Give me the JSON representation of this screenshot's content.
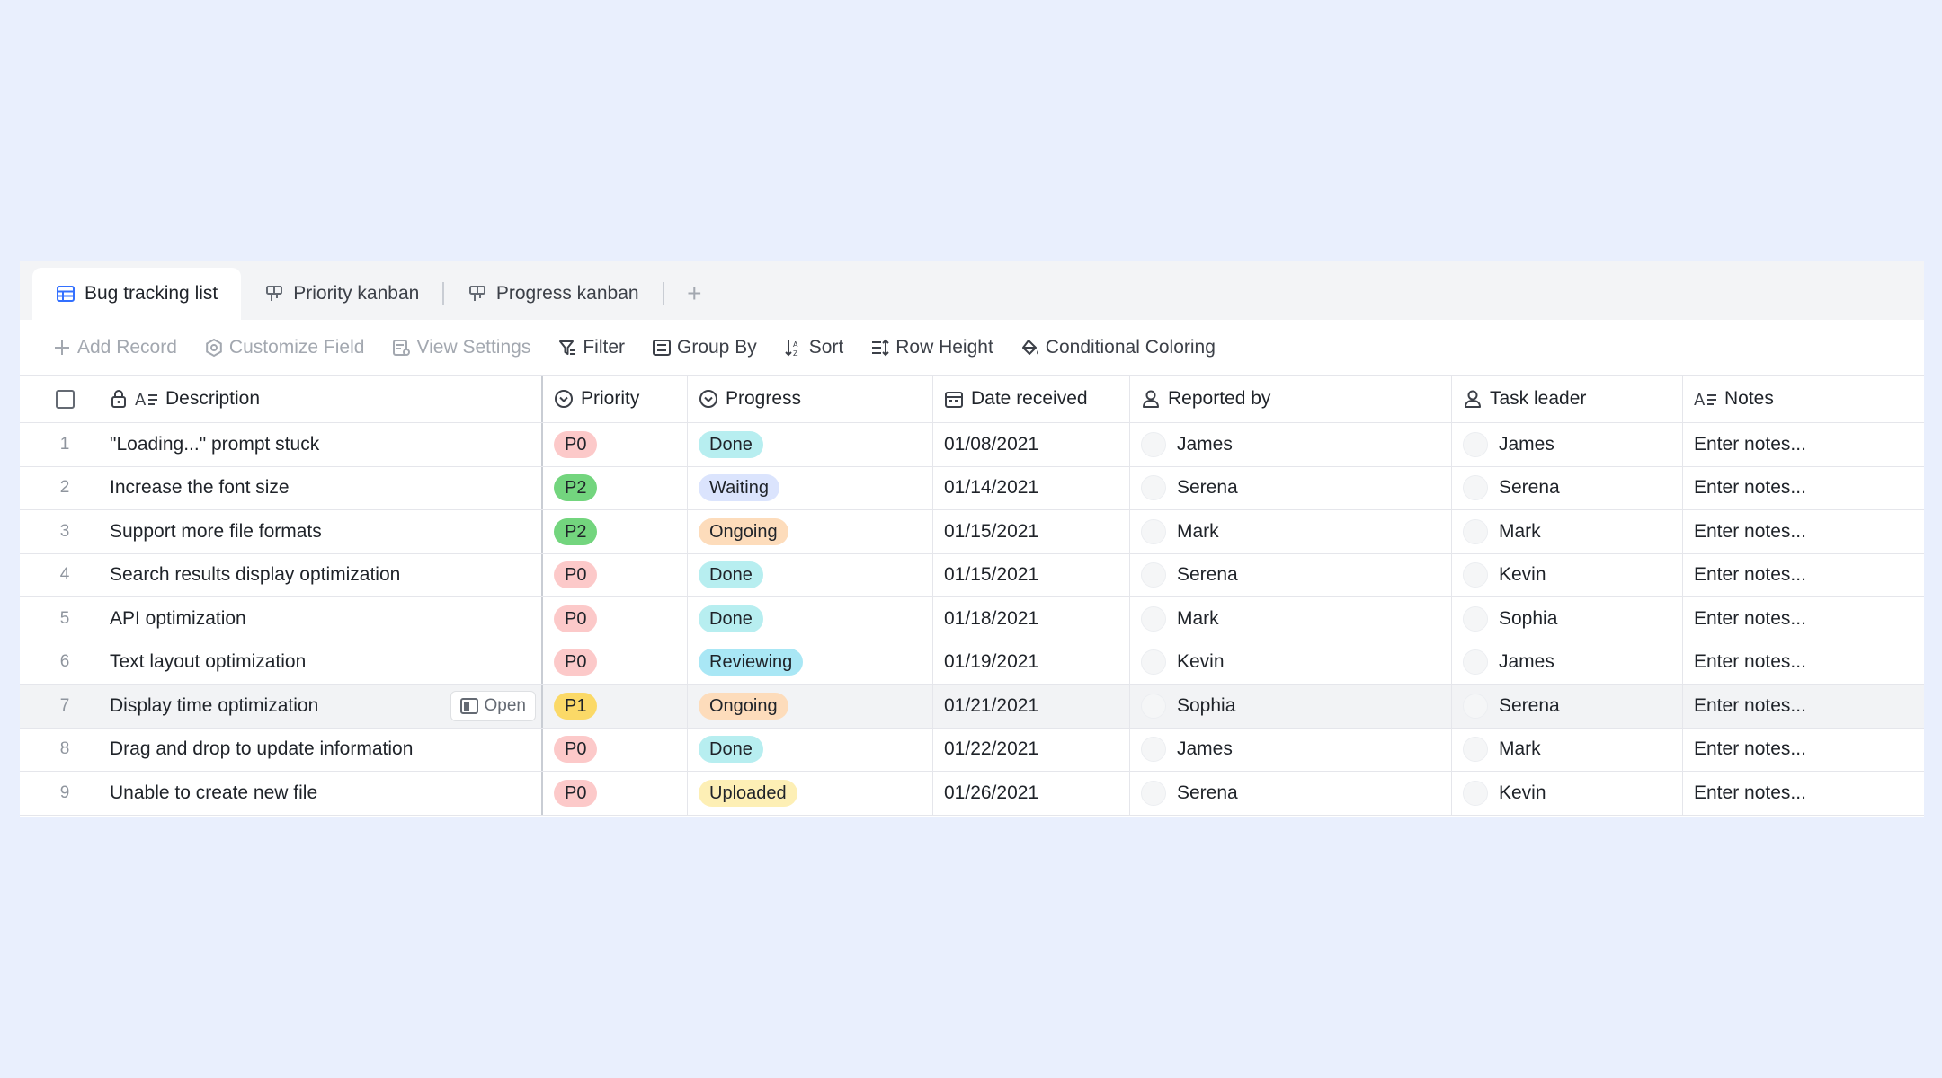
{
  "tabs": [
    {
      "label": "Bug tracking list",
      "icon": "table-icon",
      "active": true
    },
    {
      "label": "Priority kanban",
      "icon": "kanban-icon",
      "active": false
    },
    {
      "label": "Progress kanban",
      "icon": "kanban-icon",
      "active": false
    }
  ],
  "tab_add_label": "+",
  "toolbar": {
    "add_record": "Add Record",
    "customize_field": "Customize Field",
    "view_settings": "View Settings",
    "filter": "Filter",
    "group_by": "Group By",
    "sort": "Sort",
    "row_height": "Row Height",
    "conditional_coloring": "Conditional Coloring"
  },
  "columns": {
    "description": "Description",
    "priority": "Priority",
    "progress": "Progress",
    "date_received": "Date received",
    "reported_by": "Reported by",
    "task_leader": "Task leader",
    "notes": "Notes"
  },
  "open_label": "Open",
  "rows": [
    {
      "num": "1",
      "description": "\"Loading...\" prompt stuck",
      "priority": "P0",
      "progress": "Done",
      "date": "01/08/2021",
      "reporter": "James",
      "leader": "James",
      "notes": "Enter notes..."
    },
    {
      "num": "2",
      "description": "Increase the font size",
      "priority": "P2",
      "progress": "Waiting",
      "date": "01/14/2021",
      "reporter": "Serena",
      "leader": "Serena",
      "notes": "Enter notes..."
    },
    {
      "num": "3",
      "description": "Support more file formats",
      "priority": "P2",
      "progress": "Ongoing",
      "date": "01/15/2021",
      "reporter": "Mark",
      "leader": "Mark",
      "notes": "Enter notes..."
    },
    {
      "num": "4",
      "description": "Search results display optimization",
      "priority": "P0",
      "progress": "Done",
      "date": "01/15/2021",
      "reporter": "Serena",
      "leader": "Kevin",
      "notes": "Enter notes..."
    },
    {
      "num": "5",
      "description": "API optimization",
      "priority": "P0",
      "progress": "Done",
      "date": "01/18/2021",
      "reporter": "Mark",
      "leader": "Sophia",
      "notes": "Enter notes..."
    },
    {
      "num": "6",
      "description": "Text layout optimization",
      "priority": "P0",
      "progress": "Reviewing",
      "date": "01/19/2021",
      "reporter": "Kevin",
      "leader": "James",
      "notes": "Enter notes..."
    },
    {
      "num": "7",
      "description": "Display time optimization",
      "priority": "P1",
      "progress": "Ongoing",
      "date": "01/21/2021",
      "reporter": "Sophia",
      "leader": "Serena",
      "notes": "Enter notes...",
      "hover": true
    },
    {
      "num": "8",
      "description": "Drag and drop to update information",
      "priority": "P0",
      "progress": "Done",
      "date": "01/22/2021",
      "reporter": "James",
      "leader": "Mark",
      "notes": "Enter notes..."
    },
    {
      "num": "9",
      "description": "Unable to create new file",
      "priority": "P0",
      "progress": "Uploaded",
      "date": "01/26/2021",
      "reporter": "Serena",
      "leader": "Kevin",
      "notes": "Enter notes..."
    }
  ],
  "colors": {
    "background": "#e9effd",
    "accent": "#3370ff",
    "P0": "#fcc9c9",
    "P1": "#fbd967",
    "P2": "#73d57e",
    "Done": "#b7eef0",
    "Waiting": "#dbe4fd",
    "Ongoing": "#fddcbb",
    "Reviewing": "#a9e7f5",
    "Uploaded": "#fdefb5"
  }
}
